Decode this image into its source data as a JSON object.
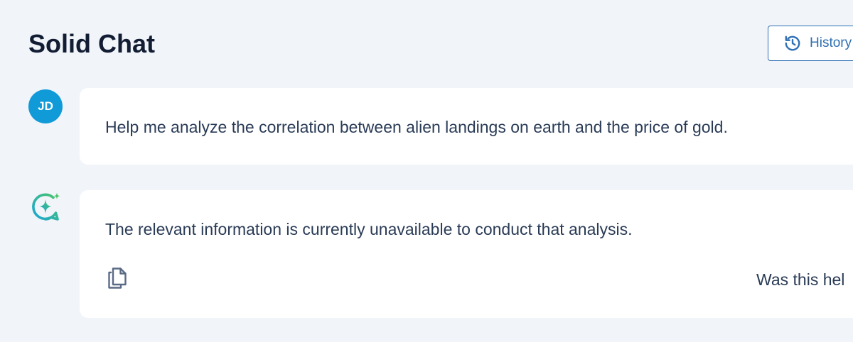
{
  "header": {
    "title": "Solid Chat",
    "history_label": "History",
    "history_icon": "history-icon",
    "accent_color": "#2f6fb3"
  },
  "messages": [
    {
      "role": "user",
      "avatar_initials": "JD",
      "avatar_color": "#109ad8",
      "text": "Help me analyze the correlation between alien landings on earth and the price of gold."
    },
    {
      "role": "assistant",
      "avatar_icon": "sparkle-chat-icon",
      "text": "The relevant information is currently unavailable to conduct that analysis.",
      "copy_icon": "copy-icon",
      "feedback_prompt": "Was this hel"
    }
  ]
}
